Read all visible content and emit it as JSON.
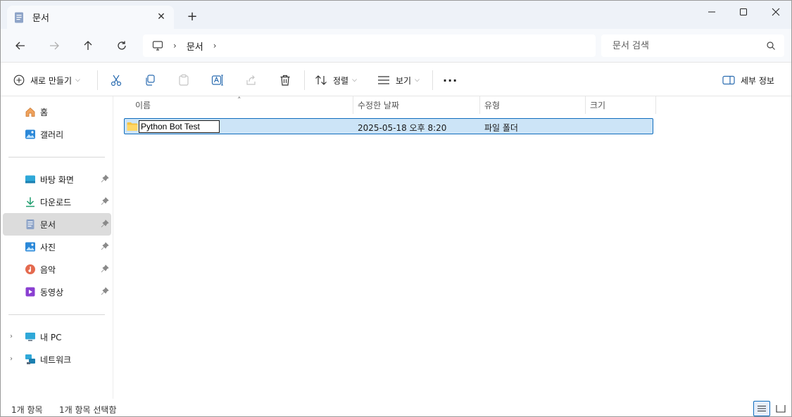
{
  "tab": {
    "title": "문서",
    "close_glyph": "✕",
    "new_tab_glyph": "+"
  },
  "window_controls": {
    "minimize": "minimize-icon",
    "maximize": "maximize-icon",
    "close": "close-icon"
  },
  "address_bar": {
    "breadcrumbs": [
      "문서"
    ],
    "separator": "›"
  },
  "search": {
    "placeholder": "문서 검색"
  },
  "toolbar": {
    "new_label": "새로 만들기",
    "sort_label": "정렬",
    "view_label": "보기",
    "more_label": "···",
    "details_label": "세부 정보"
  },
  "sidebar": {
    "top_items": [
      {
        "label": "홈",
        "icon": "home-icon"
      },
      {
        "label": "갤러리",
        "icon": "gallery-icon"
      }
    ],
    "pinned_items": [
      {
        "label": "바탕 화면",
        "icon": "desktop-icon",
        "pinned": true
      },
      {
        "label": "다운로드",
        "icon": "download-icon",
        "pinned": true
      },
      {
        "label": "문서",
        "icon": "documents-icon",
        "pinned": true,
        "selected": true
      },
      {
        "label": "사진",
        "icon": "pictures-icon",
        "pinned": true
      },
      {
        "label": "음악",
        "icon": "music-icon",
        "pinned": true
      },
      {
        "label": "동영상",
        "icon": "videos-icon",
        "pinned": true
      }
    ],
    "tree_items": [
      {
        "label": "내 PC",
        "icon": "this-pc-icon"
      },
      {
        "label": "네트워크",
        "icon": "network-icon"
      }
    ]
  },
  "columns": [
    "이름",
    "수정한 날짜",
    "유형",
    "크기"
  ],
  "files": [
    {
      "name": "Python Bot Test",
      "modified": "2025-05-18 오후 8:20",
      "type": "파일 폴더",
      "size": ""
    }
  ],
  "status": {
    "item_count": "1개 항목",
    "selected_count": "1개 항목 선택함"
  },
  "colors": {
    "accent": "#0f6cbd",
    "selection": "#cce4f7",
    "folder": "#f5c342"
  }
}
